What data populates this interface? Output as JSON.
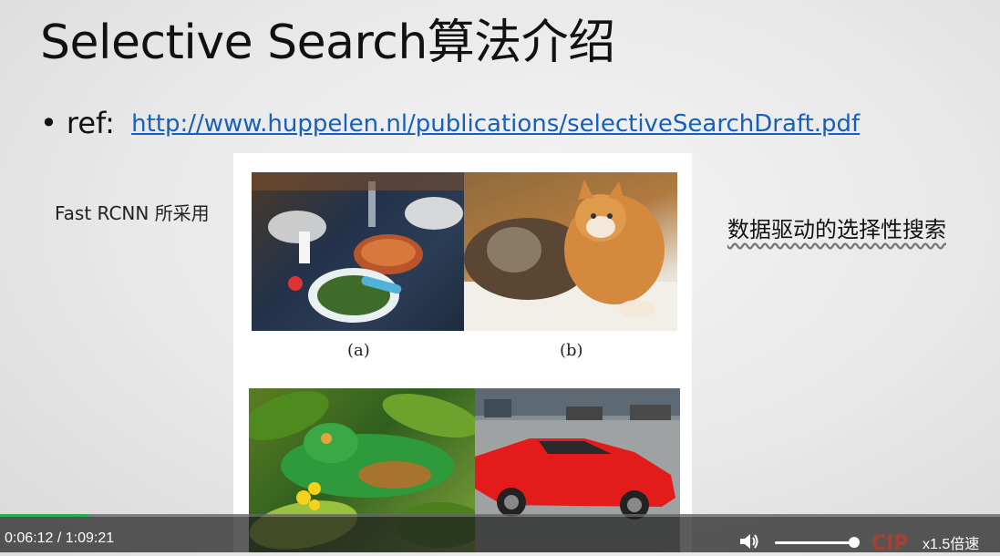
{
  "slide": {
    "title": "Selective Search算法介绍",
    "bullet_symbol": "•",
    "bullet_label": "ref:",
    "ref_url": "http://www.huppelen.nl/publications/selectiveSearchDraft.pdf",
    "side_note": "Fast RCNN 所采用",
    "right_note": "数据驱动的选择性搜索",
    "figure": {
      "captions": [
        "(a)",
        "(b)"
      ]
    }
  },
  "player": {
    "current_time": "0:06:12",
    "separator": "/",
    "total_time": "1:09:21",
    "progress_fraction": 0.089,
    "volume_fraction": 0.95,
    "speed_label": "x1.5倍速",
    "volume_icon": "speaker-icon",
    "accent_color": "#22b14c"
  }
}
